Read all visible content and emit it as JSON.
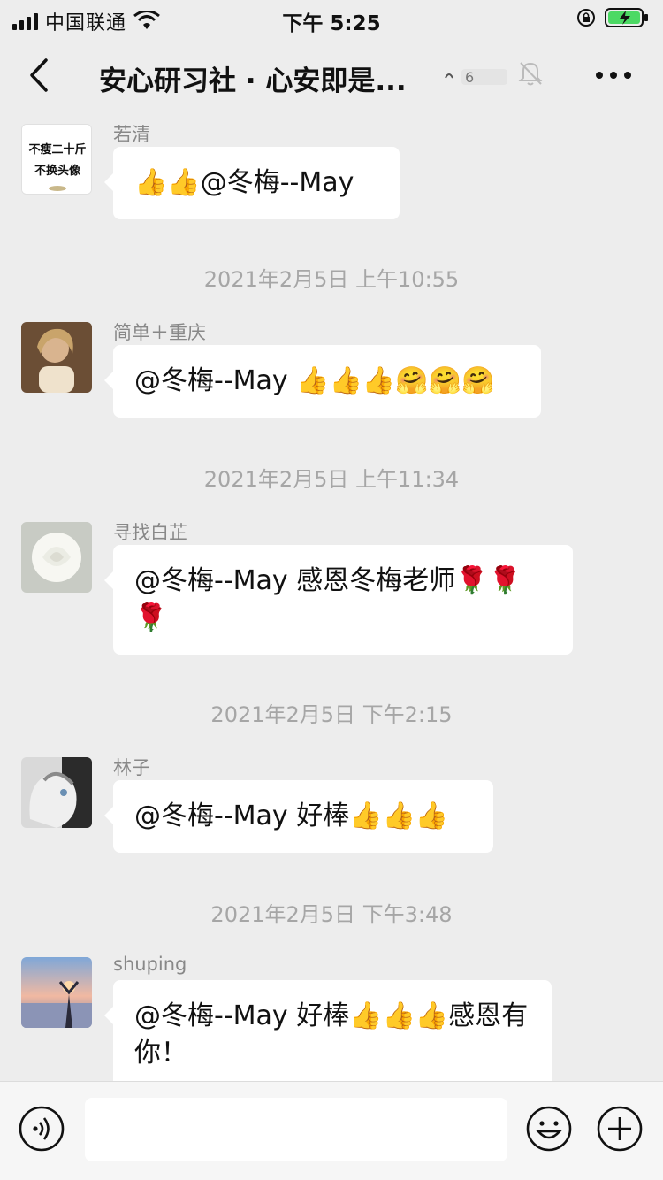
{
  "status_bar": {
    "carrier": "中国联通",
    "time": "下午 5:25"
  },
  "nav": {
    "title": "安心研习社 · 心安即是...",
    "back_icon": "chevron-left-icon",
    "mute_icon": "bell-muted-icon",
    "more_icon": "ellipsis-icon"
  },
  "messages": [
    {
      "sender": "若清",
      "text": "@冬梅--May",
      "emojis_before": "👍👍",
      "emojis_after": "",
      "avatar_text": [
        "不瘦二十斤",
        "不换头像"
      ]
    },
    {
      "sender": "简单＋重庆",
      "text": "@冬梅--May ",
      "emojis_before": "",
      "emojis_after": "👍👍👍🤗🤗🤗"
    },
    {
      "sender": "寻找白芷",
      "text": "@冬梅--May 感恩冬梅老师",
      "emojis_before": "",
      "emojis_after": "🌹🌹🌹"
    },
    {
      "sender": "林子",
      "text": "@冬梅--May 好棒",
      "emojis_before": "",
      "emojis_after": "👍👍👍"
    },
    {
      "sender": "shuping",
      "text": "@冬梅--May 好棒",
      "emojis_before": "",
      "emojis_after": "👍👍👍",
      "text_after": "感恩有你！"
    }
  ],
  "timestamps": [
    "2021年2月5日 上午10:55",
    "2021年2月5日 上午11:34",
    "2021年2月5日 下午2:15",
    "2021年2月5日 下午3:48"
  ],
  "input_bar": {
    "voice_icon": "voice-icon",
    "emoji_icon": "smiley-icon",
    "plus_icon": "plus-icon",
    "input_value": ""
  },
  "colors": {
    "background": "#ededed",
    "bubble": "#ffffff",
    "timestamp": "#a6a6a6",
    "sender": "#888888"
  }
}
